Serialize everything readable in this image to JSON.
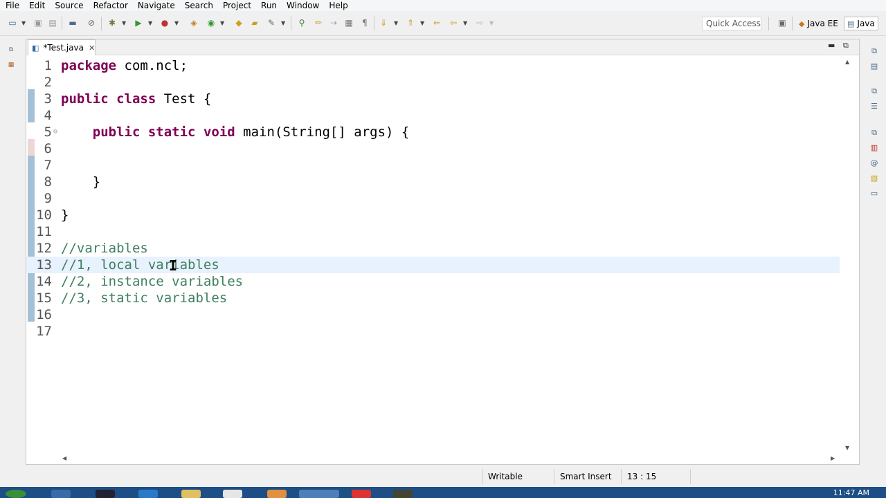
{
  "menu": [
    "File",
    "Edit",
    "Source",
    "Refactor",
    "Navigate",
    "Search",
    "Project",
    "Run",
    "Window",
    "Help"
  ],
  "toolbar": {
    "quick_access": "Quick Access",
    "perspectives": [
      "Java EE",
      "Java"
    ]
  },
  "editor": {
    "tab_label": "*Test.java",
    "lines": [
      {
        "num": "1",
        "tokens": [
          {
            "t": "package",
            "c": "kw"
          },
          {
            "t": " com.ncl;",
            "c": ""
          }
        ]
      },
      {
        "num": "2",
        "tokens": []
      },
      {
        "num": "3",
        "tokens": [
          {
            "t": "public",
            "c": "kw"
          },
          {
            "t": " ",
            "c": ""
          },
          {
            "t": "class",
            "c": "kw"
          },
          {
            "t": " Test {",
            "c": ""
          }
        ]
      },
      {
        "num": "4",
        "tokens": []
      },
      {
        "num": "5",
        "tokens": [
          {
            "t": "    ",
            "c": ""
          },
          {
            "t": "public",
            "c": "kw"
          },
          {
            "t": " ",
            "c": ""
          },
          {
            "t": "static",
            "c": "kw"
          },
          {
            "t": " ",
            "c": ""
          },
          {
            "t": "void",
            "c": "kw"
          },
          {
            "t": " main(String[] args) {",
            "c": ""
          }
        ],
        "fold": true
      },
      {
        "num": "6",
        "tokens": []
      },
      {
        "num": "7",
        "tokens": []
      },
      {
        "num": "8",
        "tokens": [
          {
            "t": "    }",
            "c": ""
          }
        ]
      },
      {
        "num": "9",
        "tokens": []
      },
      {
        "num": "10",
        "tokens": [
          {
            "t": "}",
            "c": ""
          }
        ]
      },
      {
        "num": "11",
        "tokens": []
      },
      {
        "num": "12",
        "tokens": [
          {
            "t": "//variables",
            "c": "cm"
          }
        ]
      },
      {
        "num": "13",
        "tokens": [
          {
            "t": "//1, local variables",
            "c": "cm"
          }
        ],
        "current": true
      },
      {
        "num": "14",
        "tokens": [
          {
            "t": "//2, instance variables",
            "c": "cm"
          }
        ]
      },
      {
        "num": "15",
        "tokens": [
          {
            "t": "//3, static variables",
            "c": "cm"
          }
        ]
      },
      {
        "num": "16",
        "tokens": []
      },
      {
        "num": "17",
        "tokens": []
      }
    ]
  },
  "status": {
    "writable": "Writable",
    "insert_mode": "Smart Insert",
    "position": "13 : 15"
  },
  "taskbar": {
    "clock": "11:47 AM"
  }
}
